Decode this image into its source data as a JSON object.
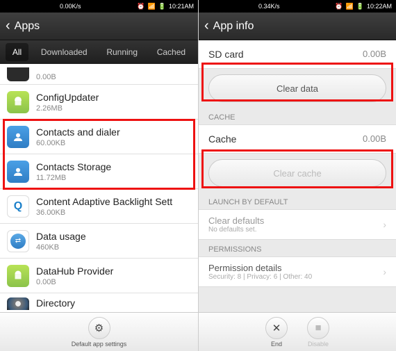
{
  "left": {
    "status": {
      "speed": "0.00K/s",
      "time": "10:21AM"
    },
    "title": "Apps",
    "tabs": [
      "All",
      "Downloaded",
      "Running",
      "Cached"
    ],
    "active_tab": 0,
    "apps": [
      {
        "name": "",
        "size": "0.00B",
        "icon": "clock"
      },
      {
        "name": "ConfigUpdater",
        "size": "2.26MB",
        "icon": "android"
      },
      {
        "name": "Contacts and dialer",
        "size": "60.00KB",
        "icon": "contact"
      },
      {
        "name": "Contacts Storage",
        "size": "11.72MB",
        "icon": "contact"
      },
      {
        "name": "Content Adaptive Backlight Sett",
        "size": "36.00KB",
        "icon": "cabl"
      },
      {
        "name": "Data usage",
        "size": "460KB",
        "icon": "data"
      },
      {
        "name": "DataHub Provider",
        "size": "0.00B",
        "icon": "android"
      },
      {
        "name": "Directory",
        "size": "",
        "icon": "disc"
      }
    ],
    "bottom": {
      "label": "Default app settings"
    }
  },
  "right": {
    "status": {
      "speed": "0.34K/s",
      "time": "10:22AM"
    },
    "title": "App info",
    "sd_label": "SD card",
    "sd_value": "0.00B",
    "clear_data": "Clear data",
    "cache_section": "CACHE",
    "cache_label": "Cache",
    "cache_value": "0.00B",
    "clear_cache": "Clear cache",
    "launch_section": "LAUNCH BY DEFAULT",
    "clear_defaults": "Clear defaults",
    "clear_defaults_sub": "No defaults set.",
    "perm_section": "PERMISSIONS",
    "perm_title": "Permission details",
    "perm_sub": "Security: 8 | Privacy: 6 | Other: 40",
    "end": "End",
    "disable": "Disable"
  }
}
